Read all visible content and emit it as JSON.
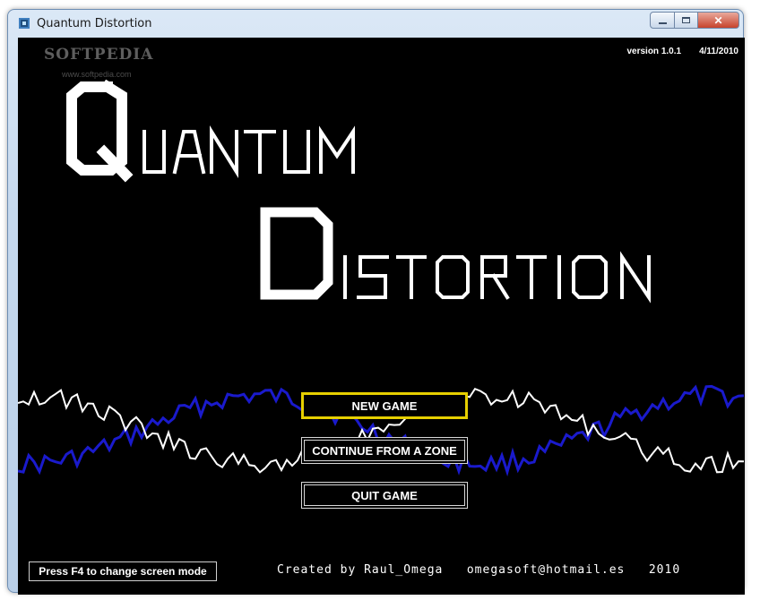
{
  "window": {
    "title": "Quantum Distortion",
    "close_glyph": "✕"
  },
  "watermark": {
    "brand": "SOFTPEDIA",
    "url": "www.softpedia.com"
  },
  "version": {
    "label": "version 1.0.1",
    "date": "4/11/2010"
  },
  "logo": {
    "line1": "Quantum",
    "line2": "Distortion"
  },
  "menu": {
    "selected": "new_game",
    "items": [
      {
        "id": "new_game",
        "label": "NEW GAME"
      },
      {
        "id": "continue",
        "label": "CONTINUE FROM A ZONE"
      },
      {
        "id": "quit",
        "label": "QUIT GAME"
      }
    ]
  },
  "footer": {
    "hint": "Press F4 to change screen mode",
    "credits": "Created by Raul_Omega   omegasoft@hotmail.es   2010"
  },
  "colors": {
    "selected_border": "#e6cf00",
    "wave_blue": "#1a1acc",
    "wave_white": "#ffffff",
    "background": "#000000"
  }
}
